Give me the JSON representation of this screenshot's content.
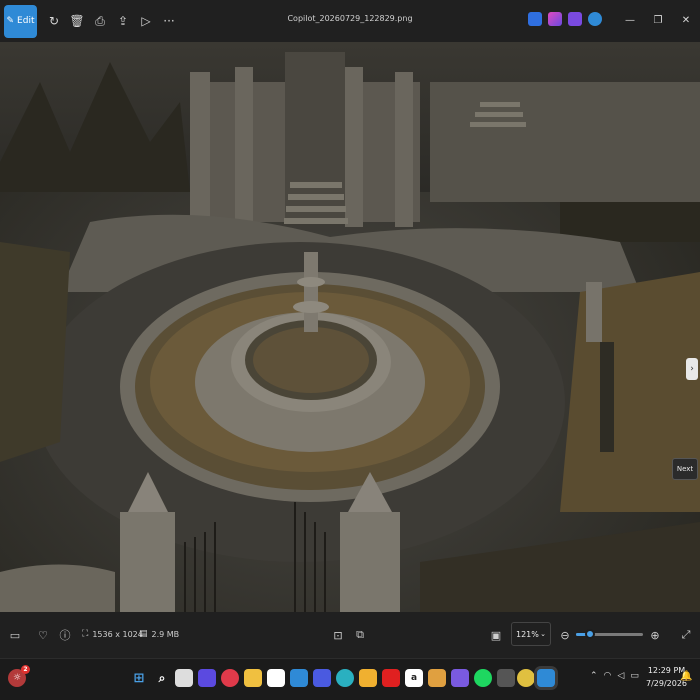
{
  "window": {
    "title": "Copilot_20260729_122829.png",
    "edit_label": "Edit"
  },
  "toolbar": {
    "icons": [
      "rotate-icon",
      "delete-icon",
      "print-icon",
      "share-icon",
      "slideshow-icon",
      "more-icon"
    ],
    "more_label": "···"
  },
  "viewer": {
    "next_label": "Next"
  },
  "infobar": {
    "dimensions": "1536 x 1024",
    "file_size": "2.9 MB",
    "zoom_value": "121%",
    "zoom_level": 0.21
  },
  "taskbar": {
    "notification_count": "2",
    "time": "12:29 PM",
    "date": "7/29/2026"
  },
  "colors": {
    "accent": "#2f8ad6",
    "toolbar_bg": "#202020",
    "taskbar_bg": "#1b1b1b"
  }
}
